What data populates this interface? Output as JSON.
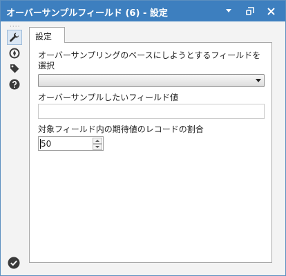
{
  "window": {
    "title": "オーバーサンプルフィールド (6) - 設定"
  },
  "titlebar_icons": [
    "chevron-down-icon",
    "restore-icon",
    "close-icon"
  ],
  "sidebar": {
    "items": [
      {
        "icon": "wrench-icon",
        "active": true
      },
      {
        "icon": "compass-icon",
        "active": false
      },
      {
        "icon": "tag-icon",
        "active": false
      },
      {
        "icon": "help-icon",
        "active": false
      }
    ],
    "bottom_icon": "checkmark-icon"
  },
  "tabs": [
    {
      "label": "設定",
      "selected": true
    }
  ],
  "form": {
    "base_field_label": "オーバーサンプリングのベースにしようとするフィールドを選択",
    "base_field_value": "",
    "oversample_value_label": "オーバーサンプルしたいフィールド値",
    "oversample_value": "",
    "percent_label": "対象フィールド内の期待値のレコードの割合",
    "percent_value": "50"
  },
  "colors": {
    "titlebar": "#3d7fbf",
    "icon_dark": "#3a3a3a"
  }
}
